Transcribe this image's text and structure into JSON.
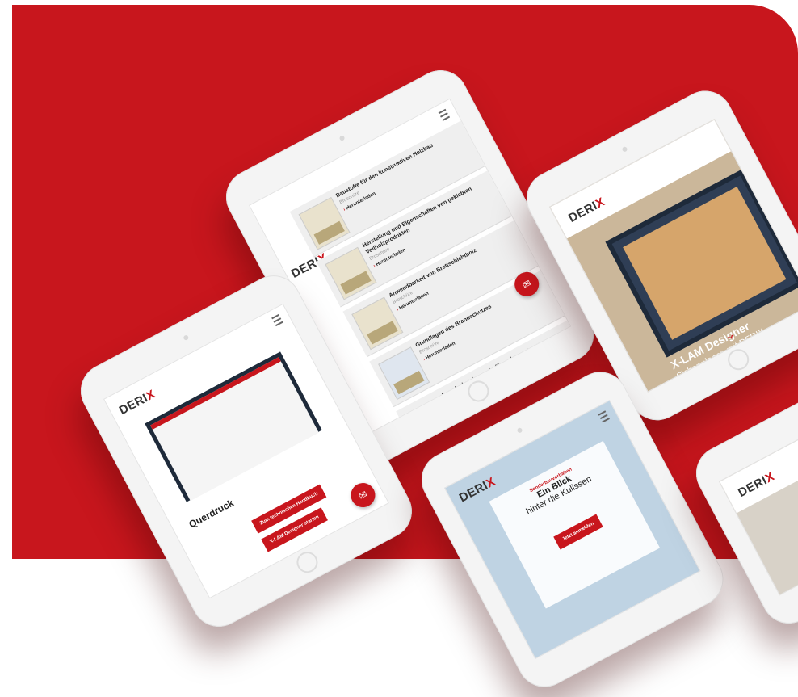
{
  "brand": {
    "logo_prefix": "DERI",
    "logo_accent": "X"
  },
  "colors": {
    "accent": "#c8161d",
    "background_red": "#c8161d"
  },
  "downloads_tablet": {
    "items": [
      {
        "title": "Baustoffe für den konstruktiven Holzbau",
        "subtitle": "Broschüre",
        "link": "Herunterladen"
      },
      {
        "title": "Herstellung und Eigenschaften von geklebten Vollholzprodukten",
        "subtitle": "Broschüre",
        "link": "Herunterladen"
      },
      {
        "title": "Anwendbarkeit von Brettschichtholz",
        "subtitle": "Broschüre",
        "link": "Herunterladen"
      },
      {
        "title": "Grundlagen des Brandschutzes",
        "subtitle": "Broschüre",
        "link": "Herunterladen"
      },
      {
        "title": "Brandschutzkonzepte für mehrgeschossige Gebäude und Aufstockungen",
        "subtitle": "",
        "link": ""
      }
    ],
    "fab_label": "✉"
  },
  "querdruck_tablet": {
    "heading": "Querdruck",
    "buttons": [
      "Zum technischen Handbuch",
      "X-LAM Designer starten"
    ],
    "fab_label": "✉"
  },
  "xlam_tablet": {
    "hero_title": "X-LAM Designer",
    "hero_subtitle": "Sicher planen mit DERIX",
    "chevron": "⌄"
  },
  "blick_tablet": {
    "kicker": "Sonderbauvorhaben",
    "title": "Ein Blick",
    "subtitle": "hinter die Kulissen",
    "button": "Jetzt anmelden"
  }
}
